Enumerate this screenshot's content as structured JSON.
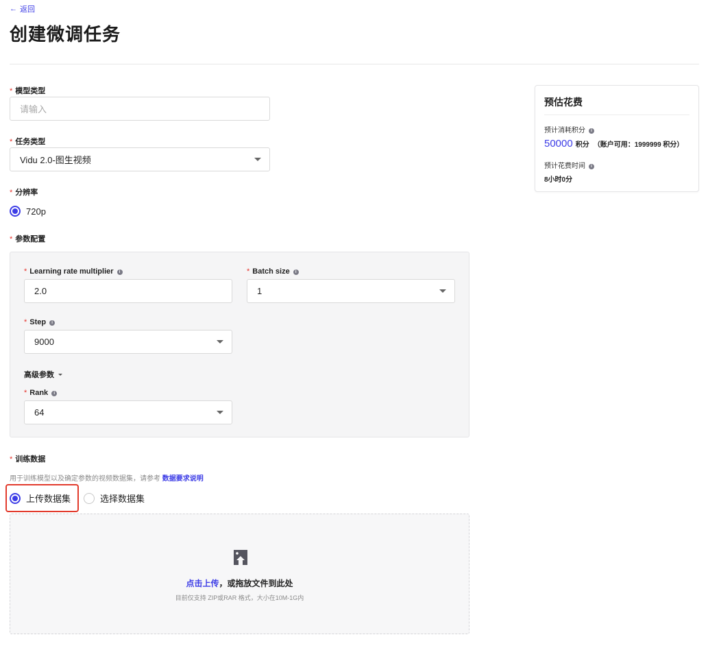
{
  "back": {
    "arrow": "←",
    "label": "返回"
  },
  "page_title": "创建微调任务",
  "model_type": {
    "label": "模型类型",
    "placeholder": "请输入"
  },
  "task_type": {
    "label": "任务类型",
    "value": "Vidu 2.0-图生视频"
  },
  "resolution": {
    "label": "分辨率",
    "option": "720p"
  },
  "params": {
    "label": "参数配置",
    "learning_rate": {
      "label": "Learning rate multiplier",
      "value": "2.0"
    },
    "batch_size": {
      "label": "Batch size",
      "value": "1"
    },
    "step": {
      "label": "Step",
      "value": "9000"
    },
    "advanced": "高级参数",
    "rank": {
      "label": "Rank",
      "value": "64"
    }
  },
  "training_data": {
    "label": "训练数据",
    "hint": "用于训练模型以及确定参数的视频数据集，请参考",
    "hint_link": "数据要求说明",
    "option_upload": "上传数据集",
    "option_select": "选择数据集",
    "upload_link": "点击上传",
    "upload_text": "，或拖放文件到此处",
    "upload_sub": "目前仅支持 ZIP或RAR 格式，大小在10M-1G内"
  },
  "cost": {
    "title": "预估花费",
    "points_label": "预计消耗积分",
    "points_value": "50000",
    "points_unit": "积分",
    "available": "（账户可用：1999999 积分）",
    "time_label": "预计花费时间",
    "time_value": "8小时0分"
  },
  "required_mark": "*",
  "info_glyph": "i",
  "colors": {
    "accent": "#3d3de6",
    "required": "#e5322b",
    "highlight": "#e23a2c"
  },
  "icons": [
    "arrow-left-icon",
    "info-icon",
    "caret-down-icon",
    "upload-image-icon"
  ]
}
